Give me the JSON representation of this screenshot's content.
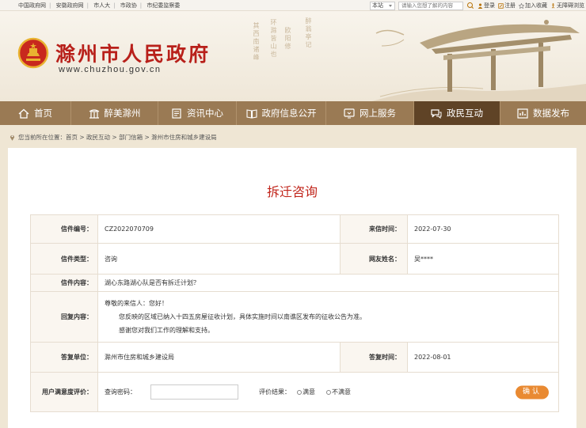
{
  "topbar": {
    "links": [
      "中国政府网",
      "安徽政府网",
      "市人大",
      "市政协",
      "市纪委监察委"
    ],
    "search_scope": "本站",
    "search_placeholder": "请输入您想了解的内容",
    "login": "登录",
    "register": "注册",
    "favorite": "加入收藏",
    "accessible": "无障碍浏览"
  },
  "header": {
    "site_name": "滁州市人民政府",
    "site_url": "www.chuzhou.gov.cn",
    "poem1": "醉翁亭记",
    "poem2": "欧阳修",
    "poem3": "环滁皆山也",
    "poem4": "其西南诸峰"
  },
  "nav": {
    "items": [
      "首页",
      "醉美滁州",
      "资讯中心",
      "政府信息公开",
      "网上服务",
      "政民互动",
      "数据发布"
    ],
    "active_index": 5
  },
  "breadcrumb": {
    "prefix": "您当前所在位置：",
    "path": "首页 > 政民互动 > 部门信箱 > 滁州市住房和城乡建设局"
  },
  "letter": {
    "title": "拆迁咨询",
    "number_label": "信件编号：",
    "number": "CZ2022070709",
    "date_label": "来信时间：",
    "date": "2022-07-30",
    "type_label": "信件类型：",
    "type": "咨询",
    "user_label": "网友姓名：",
    "user": "吴****",
    "content_label": "信件内容：",
    "content": "湖心东路湖心队是否有拆迁计划？",
    "reply_label": "回复内容：",
    "reply_greeting": "尊敬的来信人：您好！",
    "reply_body": "您反映的区域已纳入十四五房屋征收计划，具体实施时间以南谯区发布的征收公告为准。",
    "reply_thanks": "感谢您对我们工作的理解和支持。",
    "unit_label": "答复单位：",
    "unit": "滁州市住房和城乡建设局",
    "reply_date_label": "答复时间：",
    "reply_date": "2022-08-01",
    "rating_label": "用户满意度评价：",
    "password_label": "查询密码：",
    "result_label": "评价结果：",
    "satisfied": "满意",
    "unsatisfied": "不满意",
    "confirm": "确认"
  }
}
